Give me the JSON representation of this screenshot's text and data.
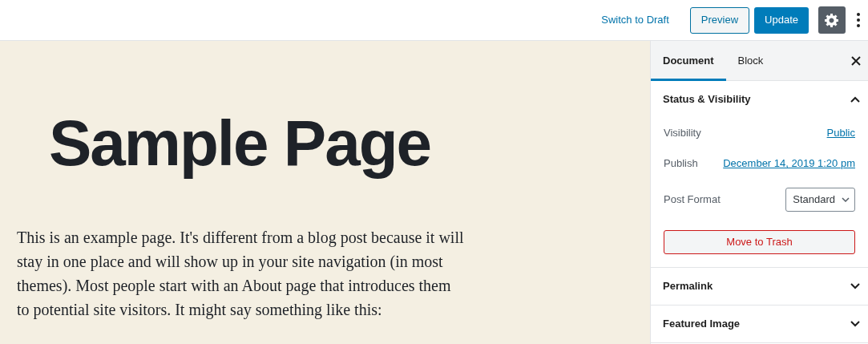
{
  "toolbar": {
    "switch_link": "Switch to Draft",
    "preview": "Preview",
    "update": "Update",
    "settings_active": true
  },
  "editor": {
    "title": "Sample Page",
    "paragraph": "This is an example page. It's different from a blog post because it will stay in one place and will show up in your site navigation (in most themes). Most people start with an About page that introduces them to potential site visitors. It might say something like this:"
  },
  "sidebar": {
    "tabs": [
      {
        "label": "Document",
        "selected": true
      },
      {
        "label": "Block",
        "selected": false
      }
    ],
    "panels": [
      {
        "title": "Status & Visibility",
        "expanded": true,
        "rows": [
          {
            "kind": "link",
            "label": "Visibility",
            "value": "Public"
          },
          {
            "kind": "link",
            "label": "Publish",
            "value": "December 14, 2019 1:20 pm"
          },
          {
            "kind": "select",
            "label": "Post Format",
            "value": "Standard"
          }
        ],
        "trash": "Move to Trash"
      },
      {
        "title": "Permalink",
        "expanded": false
      },
      {
        "title": "Featured Image",
        "expanded": false
      }
    ]
  }
}
